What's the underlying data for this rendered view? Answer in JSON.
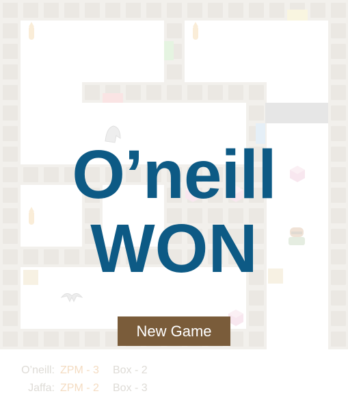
{
  "game": {
    "winner_line1": "O’neill",
    "winner_line2": "WON",
    "new_game_label": "New Game"
  },
  "players": [
    {
      "name": "O’neill:",
      "zpm": "ZPM - 3",
      "box": "Box - 2"
    },
    {
      "name": "Jaffa:",
      "zpm": "ZPM - 2",
      "box": "Box - 3"
    }
  ],
  "colors": {
    "title": "#0d5a85",
    "button": "#7a5c3a",
    "zpm_text": "#f4dcc2",
    "box_text": "#dedbd6"
  }
}
